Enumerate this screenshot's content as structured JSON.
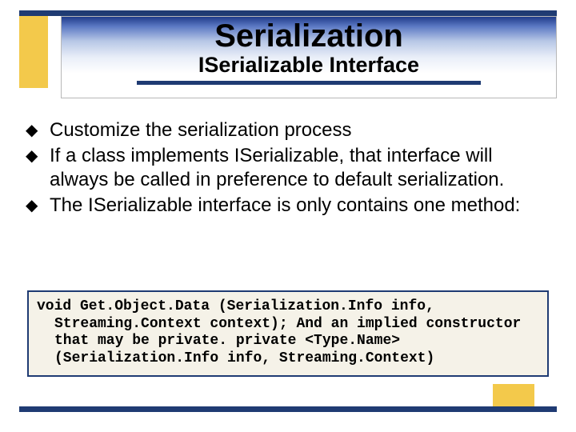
{
  "title": "Serialization",
  "subtitle": "ISerializable Interface",
  "bullets": [
    "Customize the serialization process",
    "If a class implements ISerializable, that interface will always be called in preference to default serialization.",
    "The ISerializable interface is only contains one method:"
  ],
  "code": {
    "line1": "void Get.Object.Data (Serialization.Info info,",
    "line2": "Streaming.Context context); And an implied constructor",
    "line3": "that may be private. private <Type.Name>",
    "line4": "(Serialization.Info info, Streaming.Context)"
  }
}
